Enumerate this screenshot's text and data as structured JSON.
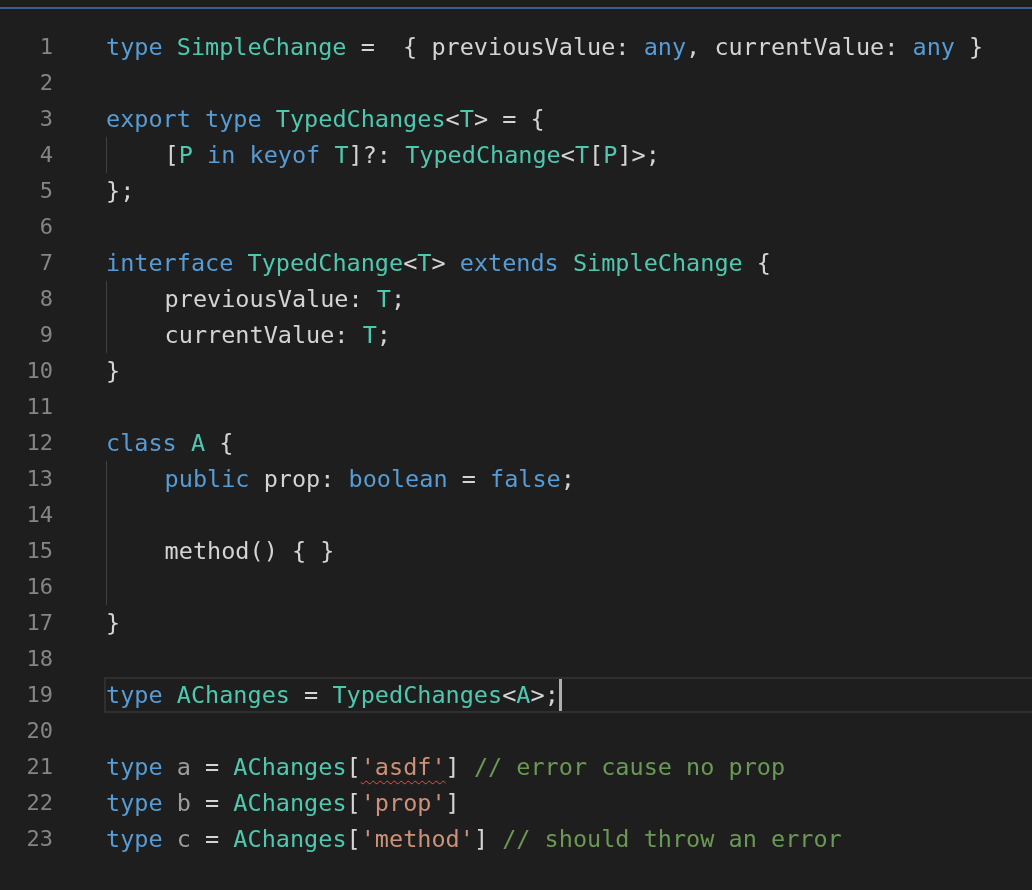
{
  "editor": {
    "lines": [
      {
        "number": "1",
        "current": false,
        "indent_guide": false,
        "tokens": [
          {
            "kind": "keyword",
            "text": "type"
          },
          {
            "kind": "type",
            "text": " SimpleChange"
          },
          {
            "kind": "plain",
            "text": " =  { previousValue: "
          },
          {
            "kind": "keyword",
            "text": "any"
          },
          {
            "kind": "plain",
            "text": ", currentValue: "
          },
          {
            "kind": "keyword",
            "text": "any"
          },
          {
            "kind": "plain",
            "text": " }"
          }
        ]
      },
      {
        "number": "2",
        "current": false,
        "indent_guide": false
      },
      {
        "number": "3",
        "current": false,
        "indent_guide": false,
        "tokens": [
          {
            "kind": "keyword",
            "text": "export"
          },
          {
            "kind": "keyword",
            "text": " type"
          },
          {
            "kind": "type",
            "text": " TypedChanges"
          },
          {
            "kind": "plain",
            "text": "<"
          },
          {
            "kind": "type",
            "text": "T"
          },
          {
            "kind": "plain",
            "text": "> = {"
          }
        ]
      },
      {
        "number": "4",
        "current": false,
        "indent_guide": true,
        "tokens": [
          {
            "kind": "plain",
            "text": "    ["
          },
          {
            "kind": "type",
            "text": "P"
          },
          {
            "kind": "keyword",
            "text": " in"
          },
          {
            "kind": "keyword",
            "text": " keyof"
          },
          {
            "kind": "type",
            "text": " T"
          },
          {
            "kind": "plain",
            "text": "]?: "
          },
          {
            "kind": "type",
            "text": "TypedChange"
          },
          {
            "kind": "plain",
            "text": "<"
          },
          {
            "kind": "type",
            "text": "T"
          },
          {
            "kind": "plain",
            "text": "["
          },
          {
            "kind": "type",
            "text": "P"
          },
          {
            "kind": "plain",
            "text": "]>;"
          }
        ]
      },
      {
        "number": "5",
        "current": false,
        "indent_guide": false,
        "tokens": [
          {
            "kind": "plain",
            "text": "};"
          }
        ]
      },
      {
        "number": "6",
        "current": false,
        "indent_guide": false
      },
      {
        "number": "7",
        "current": false,
        "indent_guide": false,
        "tokens": [
          {
            "kind": "keyword",
            "text": "interface"
          },
          {
            "kind": "type",
            "text": " TypedChange"
          },
          {
            "kind": "plain",
            "text": "<"
          },
          {
            "kind": "type",
            "text": "T"
          },
          {
            "kind": "plain",
            "text": "> "
          },
          {
            "kind": "keyword",
            "text": "extends"
          },
          {
            "kind": "type",
            "text": " SimpleChange"
          },
          {
            "kind": "plain",
            "text": " {"
          }
        ]
      },
      {
        "number": "8",
        "current": false,
        "indent_guide": true,
        "tokens": [
          {
            "kind": "plain",
            "text": "    previousValue: "
          },
          {
            "kind": "type",
            "text": "T"
          },
          {
            "kind": "plain",
            "text": ";"
          }
        ]
      },
      {
        "number": "9",
        "current": false,
        "indent_guide": true,
        "tokens": [
          {
            "kind": "plain",
            "text": "    currentValue: "
          },
          {
            "kind": "type",
            "text": "T"
          },
          {
            "kind": "plain",
            "text": ";"
          }
        ]
      },
      {
        "number": "10",
        "current": false,
        "indent_guide": false,
        "tokens": [
          {
            "kind": "plain",
            "text": "}"
          }
        ]
      },
      {
        "number": "11",
        "current": false,
        "indent_guide": false
      },
      {
        "number": "12",
        "current": false,
        "indent_guide": false,
        "tokens": [
          {
            "kind": "keyword",
            "text": "class"
          },
          {
            "kind": "type",
            "text": " A"
          },
          {
            "kind": "plain",
            "text": " {"
          }
        ]
      },
      {
        "number": "13",
        "current": false,
        "indent_guide": true,
        "tokens": [
          {
            "kind": "keyword",
            "text": "    public"
          },
          {
            "kind": "plain",
            "text": " prop: "
          },
          {
            "kind": "keyword",
            "text": "boolean"
          },
          {
            "kind": "plain",
            "text": " = "
          },
          {
            "kind": "keyword",
            "text": "false"
          },
          {
            "kind": "plain",
            "text": ";"
          }
        ]
      },
      {
        "number": "14",
        "current": false,
        "indent_guide": true
      },
      {
        "number": "15",
        "current": false,
        "indent_guide": true,
        "tokens": [
          {
            "kind": "plain",
            "text": "    method() { }"
          }
        ]
      },
      {
        "number": "16",
        "current": false,
        "indent_guide": true
      },
      {
        "number": "17",
        "current": false,
        "indent_guide": false,
        "tokens": [
          {
            "kind": "plain",
            "text": "}"
          }
        ]
      },
      {
        "number": "18",
        "current": false,
        "indent_guide": false
      },
      {
        "number": "19",
        "current": true,
        "indent_guide": false,
        "tokens": [
          {
            "kind": "keyword",
            "text": "type"
          },
          {
            "kind": "type",
            "text": " AChanges"
          },
          {
            "kind": "plain",
            "text": " = "
          },
          {
            "kind": "type",
            "text": "TypedChanges"
          },
          {
            "kind": "plain",
            "text": "<"
          },
          {
            "kind": "type",
            "text": "A"
          },
          {
            "kind": "plain",
            "text": ">;"
          }
        ]
      },
      {
        "number": "20",
        "current": false,
        "indent_guide": false
      },
      {
        "number": "21",
        "current": false,
        "indent_guide": false,
        "tokens": [
          {
            "kind": "keyword",
            "text": "type"
          },
          {
            "kind": "unused",
            "text": " a"
          },
          {
            "kind": "plain",
            "text": " = "
          },
          {
            "kind": "type",
            "text": "AChanges"
          },
          {
            "kind": "plain",
            "text": "["
          },
          {
            "kind": "string",
            "text": "'asdf'",
            "error": true
          },
          {
            "kind": "plain",
            "text": "] "
          },
          {
            "kind": "comment",
            "text": "// error cause no prop"
          }
        ]
      },
      {
        "number": "22",
        "current": false,
        "indent_guide": false,
        "tokens": [
          {
            "kind": "keyword",
            "text": "type"
          },
          {
            "kind": "unused",
            "text": " b"
          },
          {
            "kind": "plain",
            "text": " = "
          },
          {
            "kind": "type",
            "text": "AChanges"
          },
          {
            "kind": "plain",
            "text": "["
          },
          {
            "kind": "string",
            "text": "'prop'"
          },
          {
            "kind": "plain",
            "text": "]"
          }
        ]
      },
      {
        "number": "23",
        "current": false,
        "indent_guide": false,
        "tokens": [
          {
            "kind": "keyword",
            "text": "type"
          },
          {
            "kind": "unused",
            "text": " c"
          },
          {
            "kind": "plain",
            "text": " = "
          },
          {
            "kind": "type",
            "text": "AChanges"
          },
          {
            "kind": "plain",
            "text": "["
          },
          {
            "kind": "string",
            "text": "'method'"
          },
          {
            "kind": "plain",
            "text": "] "
          },
          {
            "kind": "comment",
            "text": "// should throw an error"
          }
        ]
      }
    ]
  }
}
